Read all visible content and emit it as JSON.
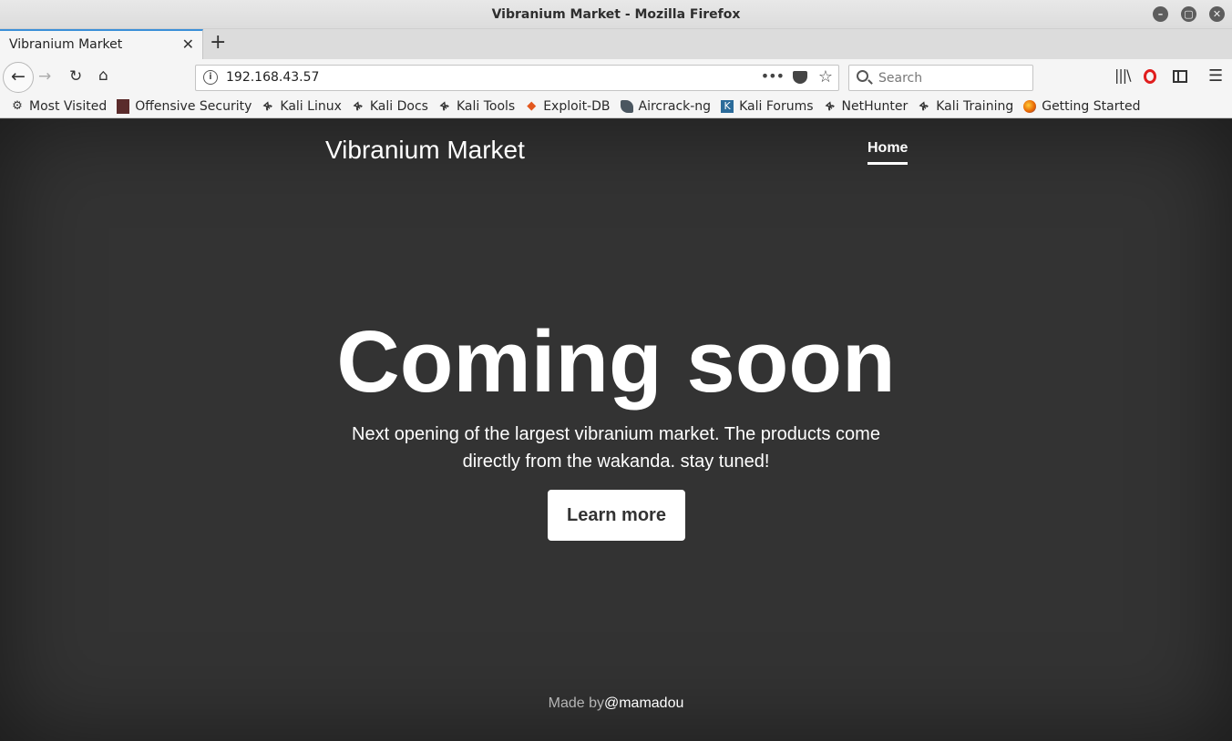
{
  "window": {
    "title": "Vibranium Market - Mozilla Firefox",
    "buttons": [
      "–",
      "▢",
      "✕"
    ]
  },
  "tab": {
    "title": "Vibranium Market",
    "close": "✕",
    "new_tab": "+"
  },
  "nav": {
    "url": "192.168.43.57",
    "search_placeholder": "Search",
    "more": "•••"
  },
  "bookmarks": [
    {
      "label": "Most Visited",
      "icon": "gear-icon"
    },
    {
      "label": "Offensive Security",
      "icon": "offsec-icon"
    },
    {
      "label": "Kali Linux",
      "icon": "kali-dragon-icon"
    },
    {
      "label": "Kali Docs",
      "icon": "kali-dragon-icon"
    },
    {
      "label": "Kali Tools",
      "icon": "kali-dragon-icon"
    },
    {
      "label": "Exploit-DB",
      "icon": "exploit-db-icon"
    },
    {
      "label": "Aircrack-ng",
      "icon": "aircrack-icon"
    },
    {
      "label": "Kali Forums",
      "icon": "kali-forums-icon"
    },
    {
      "label": "NetHunter",
      "icon": "kali-dragon-icon"
    },
    {
      "label": "Kali Training",
      "icon": "kali-dragon-icon"
    },
    {
      "label": "Getting Started",
      "icon": "firefox-icon"
    }
  ],
  "page": {
    "brand": "Vibranium Market",
    "nav_home": "Home",
    "hero_title": "Coming soon",
    "hero_lead": "Next opening of the largest vibranium market. The products come directly from the wakanda. stay tuned!",
    "button": "Learn more",
    "footer_prefix": "Made by",
    "footer_link": "@mamadou"
  }
}
